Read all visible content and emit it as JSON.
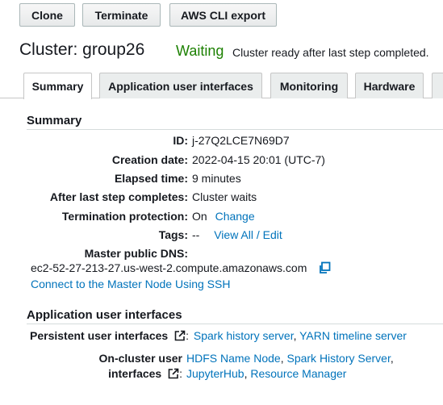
{
  "toolbar": {
    "clone_label": "Clone",
    "terminate_label": "Terminate",
    "aws_cli_export_label": "AWS CLI export"
  },
  "cluster": {
    "title": "Cluster: group26",
    "status": "Waiting",
    "status_message": "Cluster ready after last step completed."
  },
  "tabs": [
    {
      "label": "Summary",
      "active": true
    },
    {
      "label": "Application user interfaces",
      "active": false
    },
    {
      "label": "Monitoring",
      "active": false
    },
    {
      "label": "Hardware",
      "active": false
    }
  ],
  "summary": {
    "heading": "Summary",
    "id_label": "ID:",
    "id_value": "j-27Q2LCE7N69D7",
    "creation_label": "Creation date:",
    "creation_value": "2022-04-15 20:01 (UTC-7)",
    "elapsed_label": "Elapsed time:",
    "elapsed_value": "9 minutes",
    "after_last_step_label": "After last step completes:",
    "after_last_step_value": "Cluster waits",
    "termination_label": "Termination protection:",
    "termination_value": "On",
    "termination_change_link": "Change",
    "tags_label": "Tags:",
    "tags_value": "--",
    "tags_link": "View All / Edit",
    "master_dns_label": "Master public DNS:",
    "master_dns_value": "ec2-52-27-213-27.us-west-2.compute.amazonaws.com",
    "ssh_link": "Connect to the Master Node Using SSH"
  },
  "app_ui": {
    "heading": "Application user interfaces",
    "persistent_label": "Persistent user interfaces",
    "persistent_links": [
      "Spark history server",
      "YARN timeline server"
    ],
    "on_cluster_label_line1": "On-cluster user",
    "on_cluster_label_line2": "interfaces",
    "on_cluster_links_line1": [
      "HDFS Name Node",
      "Spark History Server"
    ],
    "on_cluster_links_line2": [
      "JupyterHub",
      "Resource Manager"
    ]
  },
  "colors": {
    "status_green": "#1d8102",
    "link_blue": "#0073bb"
  }
}
